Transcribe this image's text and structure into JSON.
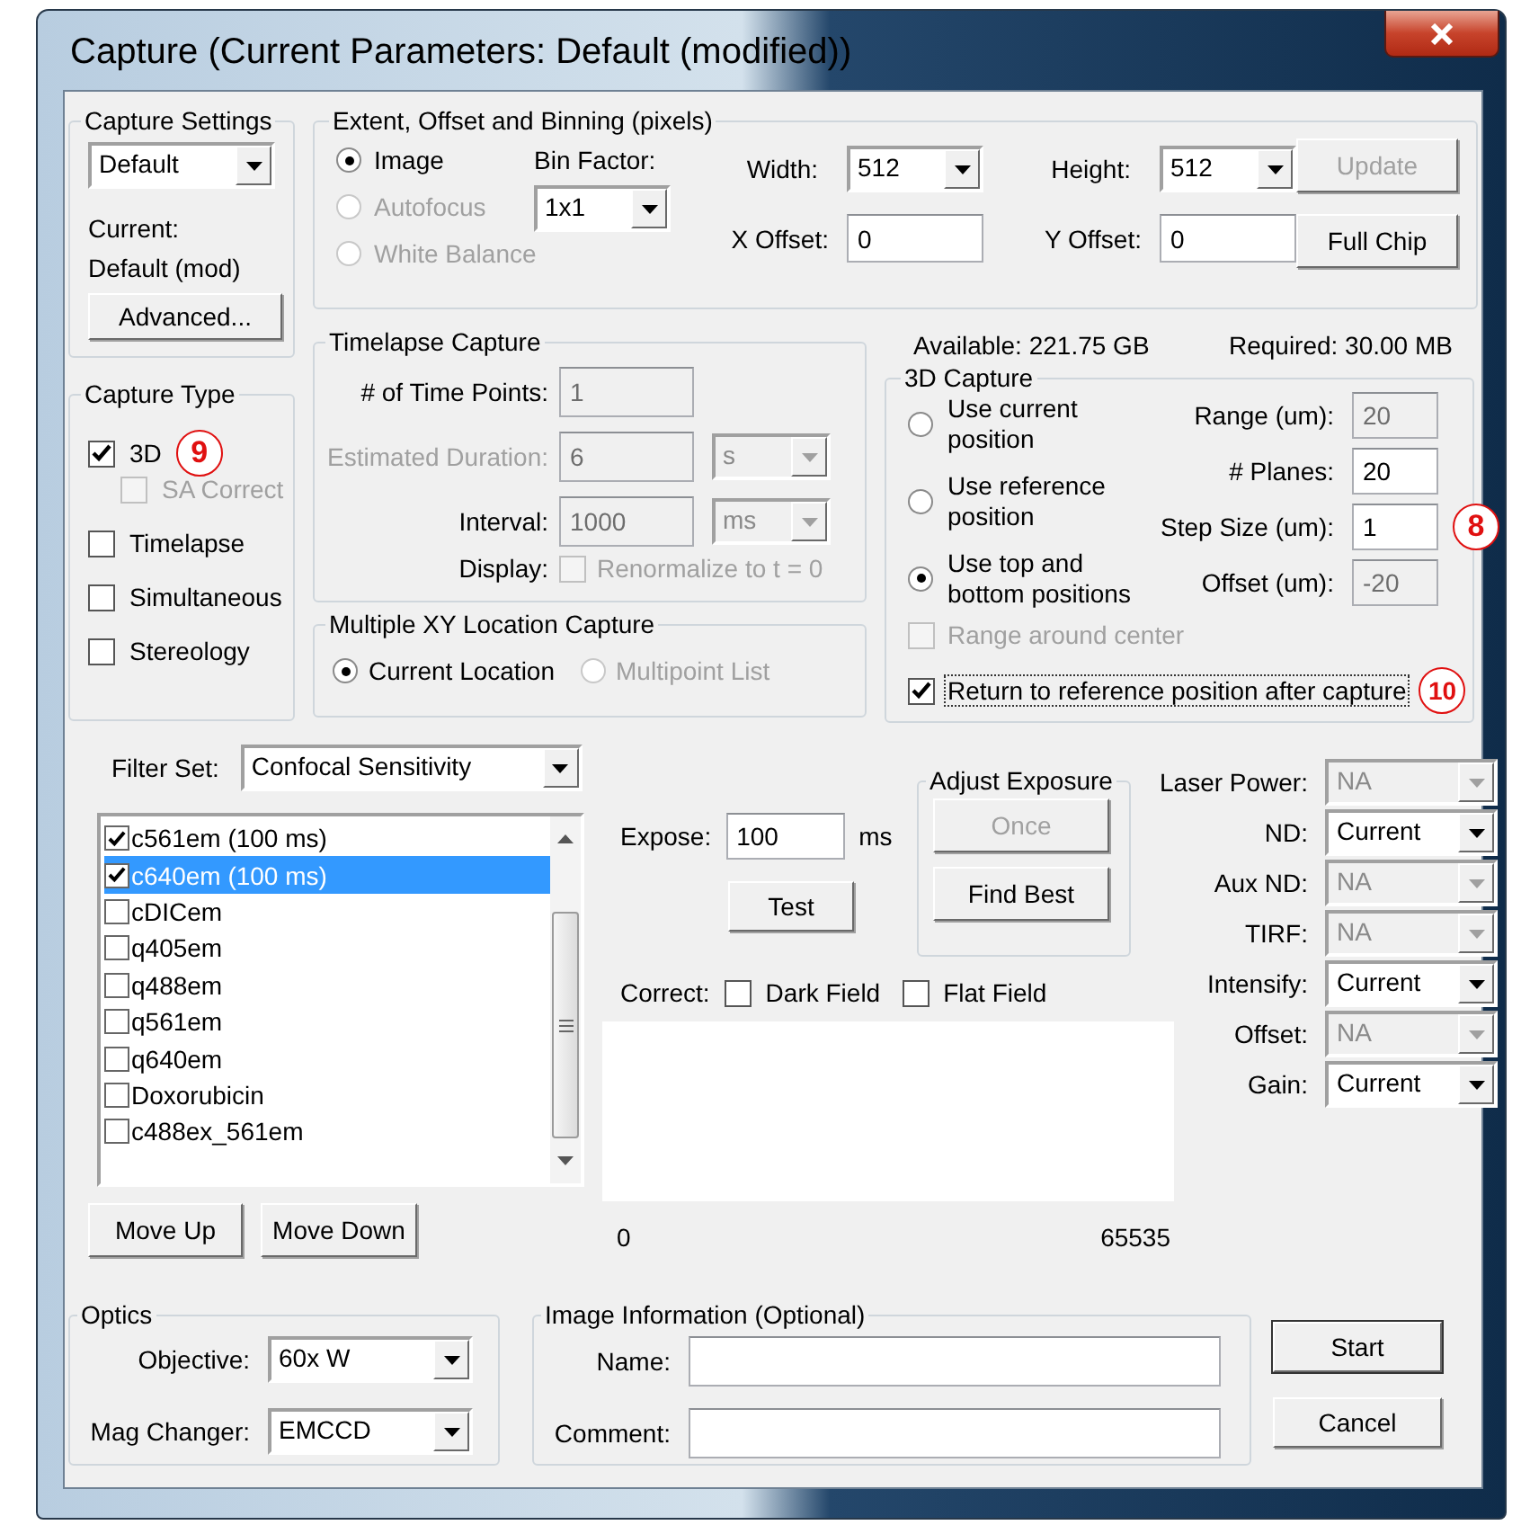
{
  "window": {
    "title": "Capture (Current Parameters: Default (modified))"
  },
  "capture_settings": {
    "title": "Capture Settings",
    "preset": "Default",
    "current_label": "Current:",
    "current_value": "Default (mod)",
    "advanced_button": "Advanced..."
  },
  "extent": {
    "title": "Extent, Offset and Binning (pixels)",
    "modes": [
      {
        "label": "Image",
        "selected": true,
        "disabled": false
      },
      {
        "label": "Autofocus",
        "selected": false,
        "disabled": true
      },
      {
        "label": "White Balance",
        "selected": false,
        "disabled": true
      }
    ],
    "bin_factor": {
      "label": "Bin Factor:",
      "value": "1x1"
    },
    "sizes": [
      {
        "label": "Width:",
        "value": "512",
        "kind": "dropdown"
      },
      {
        "label": "Height:",
        "value": "512",
        "kind": "dropdown"
      },
      {
        "label": "X Offset:",
        "value": "0",
        "kind": "field"
      },
      {
        "label": "Y Offset:",
        "value": "0",
        "kind": "field"
      }
    ],
    "buttons": [
      {
        "label": "Update",
        "disabled": true
      },
      {
        "label": "Full Chip",
        "disabled": false
      }
    ]
  },
  "capture_type": {
    "title": "Capture Type",
    "options": [
      {
        "label": "3D",
        "checked": true,
        "disabled": false,
        "callout": "9",
        "children": [
          {
            "label": "SA Correct",
            "checked": false,
            "disabled": true
          }
        ]
      },
      {
        "label": "Timelapse",
        "checked": false,
        "disabled": false
      },
      {
        "label": "Simultaneous",
        "checked": false,
        "disabled": false
      },
      {
        "label": "Stereology",
        "checked": false,
        "disabled": false
      }
    ]
  },
  "timelapse": {
    "title": "Timelapse Capture",
    "fields": [
      {
        "label": "# of Time Points:",
        "disabled": false,
        "value": "1"
      },
      {
        "label": "Estimated Duration:",
        "disabled": true,
        "value": "6",
        "unit": "s"
      },
      {
        "label": "Interval:",
        "disabled": false,
        "value": "1000",
        "unit": "ms"
      }
    ],
    "display": {
      "label": "Display:",
      "option": "Renormalize to t = 0",
      "checked": false,
      "disabled": true
    }
  },
  "multi_xy": {
    "title": "Multiple XY Location Capture",
    "options": [
      {
        "label": "Current Location",
        "selected": true,
        "disabled": false
      },
      {
        "label": "Multipoint List",
        "selected": false,
        "disabled": true
      }
    ]
  },
  "storage": {
    "available": "Available: 221.75 GB",
    "required": "Required: 30.00 MB"
  },
  "capture_3d": {
    "title": "3D Capture",
    "modes": [
      {
        "label": "Use current position",
        "selected": false
      },
      {
        "label": "Use reference position",
        "selected": false
      },
      {
        "label": "Use top and bottom positions",
        "selected": true
      }
    ],
    "fields": [
      {
        "label": "Range (um):",
        "value": "20",
        "disabled": true
      },
      {
        "label": "# Planes:",
        "value": "20",
        "disabled": false
      },
      {
        "label": "Step Size (um):",
        "value": "1",
        "disabled": false,
        "callout": "8"
      },
      {
        "label": "Offset (um):",
        "value": "-20",
        "disabled": true
      }
    ],
    "options": [
      {
        "label": "Range around center",
        "checked": false,
        "disabled": true,
        "focused": false
      },
      {
        "label": "Return to reference position after capture",
        "checked": true,
        "disabled": false,
        "focused": true,
        "callout": "10"
      }
    ]
  },
  "filter": {
    "label": "Filter Set:",
    "value": "Confocal Sensitivity",
    "items": [
      {
        "label": "c561em (100 ms)",
        "checked": true,
        "selected": false
      },
      {
        "label": "c640em (100 ms)",
        "checked": true,
        "selected": true
      },
      {
        "label": "cDICem",
        "checked": false,
        "selected": false
      },
      {
        "label": "q405em",
        "checked": false,
        "selected": false
      },
      {
        "label": "q488em",
        "checked": false,
        "selected": false
      },
      {
        "label": "q561em",
        "checked": false,
        "selected": false
      },
      {
        "label": "q640em",
        "checked": false,
        "selected": false
      },
      {
        "label": "Doxorubicin",
        "checked": false,
        "selected": false
      },
      {
        "label": "c488ex_561em",
        "checked": false,
        "selected": false
      }
    ],
    "buttons": [
      "Move Up",
      "Move Down"
    ]
  },
  "exposure": {
    "label": "Expose:",
    "value": "100",
    "unit": "ms",
    "test_button": "Test",
    "adjust": {
      "title": "Adjust Exposure",
      "buttons": [
        {
          "label": "Once",
          "disabled": true
        },
        {
          "label": "Find Best",
          "disabled": false
        }
      ]
    },
    "correct": {
      "label": "Correct:",
      "options": [
        {
          "label": "Dark Field",
          "checked": false
        },
        {
          "label": "Flat Field",
          "checked": false
        }
      ]
    },
    "histogram": {
      "min": "0",
      "max": "65535"
    }
  },
  "hardware": [
    {
      "label": "Laser Power:",
      "value": "NA",
      "disabled": true
    },
    {
      "label": "ND:",
      "value": "Current",
      "disabled": false
    },
    {
      "label": "Aux ND:",
      "value": "NA",
      "disabled": true
    },
    {
      "label": "TIRF:",
      "value": "NA",
      "disabled": true
    },
    {
      "label": "Intensify:",
      "value": "Current",
      "disabled": false
    },
    {
      "label": "Offset:",
      "value": "NA",
      "disabled": true
    },
    {
      "label": "Gain:",
      "value": "Current",
      "disabled": false
    }
  ],
  "optics": {
    "title": "Optics",
    "fields": [
      {
        "label": "Objective:",
        "value": "60x W"
      },
      {
        "label": "Mag Changer:",
        "value": "EMCCD"
      }
    ]
  },
  "image_info": {
    "title": "Image Information (Optional)",
    "fields": [
      {
        "label": "Name:"
      },
      {
        "label": "Comment:"
      }
    ]
  },
  "actions": [
    {
      "label": "Start",
      "default": true
    },
    {
      "label": "Cancel",
      "default": false
    }
  ]
}
